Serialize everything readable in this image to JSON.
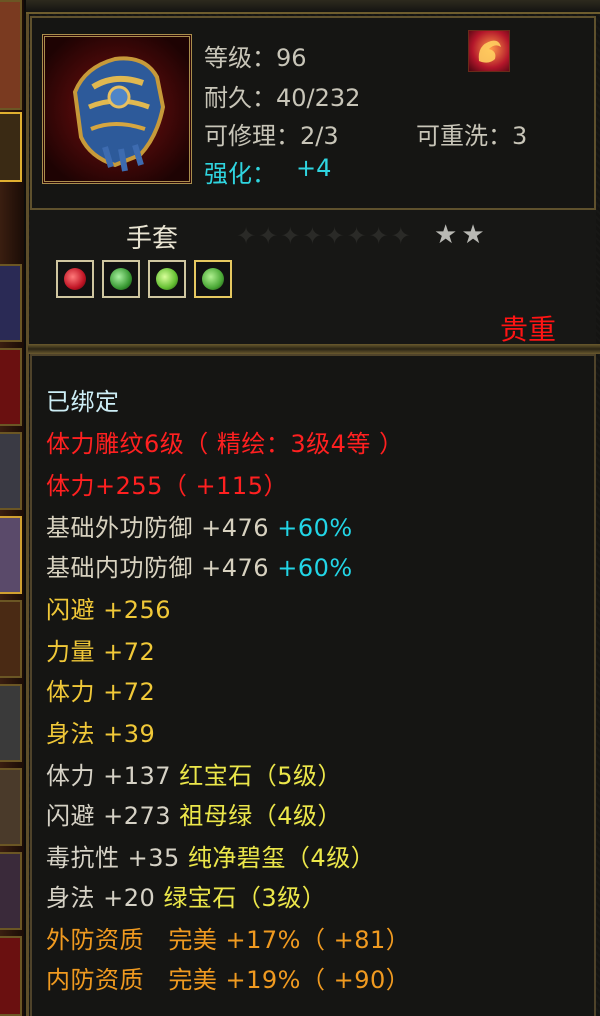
{
  "item": {
    "name": "手套",
    "rarity": "贵重",
    "star_count": 2,
    "enhance_label": "强化：",
    "enhance_value": "+4",
    "stats": {
      "level": "等级：96",
      "durability": "耐久：40/232",
      "repair": "可修理：2/3",
      "reforge": "可重洗：3"
    },
    "gems": [
      {
        "name": "red-gem",
        "color": "#d8283a"
      },
      {
        "name": "emerald-gem",
        "color": "#3faa3a"
      },
      {
        "name": "jade-gem",
        "color": "#6ccc3a"
      },
      {
        "name": "green-gem",
        "color": "#58b83a"
      }
    ]
  },
  "attributes": {
    "bound": "已绑定",
    "engraving": "体力雕纹6级（ 精绘：3级4等 ）",
    "vitality_main": "体力+255（ +115）",
    "base_ext_def": "基础外功防御",
    "base_ext_def_val": "+476",
    "base_ext_def_pct": "+60%",
    "base_int_def": "基础内功防御",
    "base_int_def_val": "+476",
    "base_int_def_pct": "+60%",
    "dodge": "闪避",
    "dodge_val": "+256",
    "strength": "力量",
    "strength_val": "+72",
    "vitality": "体力",
    "vitality_val": "+72",
    "agility": "身法",
    "agility_val": "+39",
    "gem_lines": [
      {
        "stat": "体力",
        "val": "+137",
        "gem": "红宝石（5级）"
      },
      {
        "stat": "闪避",
        "val": "+273",
        "gem": "祖母绿（4级）"
      },
      {
        "stat": "毒抗性",
        "val": "+35",
        "gem": "纯净碧玺（4级）"
      },
      {
        "stat": "身法",
        "val": "+20",
        "gem": "绿宝石（3级）"
      }
    ],
    "quality_lines": [
      {
        "stat": "外防资质",
        "grade": "完美",
        "val": "+17%（ +81）"
      },
      {
        "stat": "内防资质",
        "grade": "完美",
        "val": "+19%（ +90）"
      }
    ]
  },
  "colors": {
    "red": "#ff2020",
    "cyan": "#22d5e6",
    "gold": "#f0c838",
    "orange": "#f09a20"
  },
  "icons": [
    "gauntlet-icon",
    "fire-skill-icon",
    "star-icon"
  ]
}
